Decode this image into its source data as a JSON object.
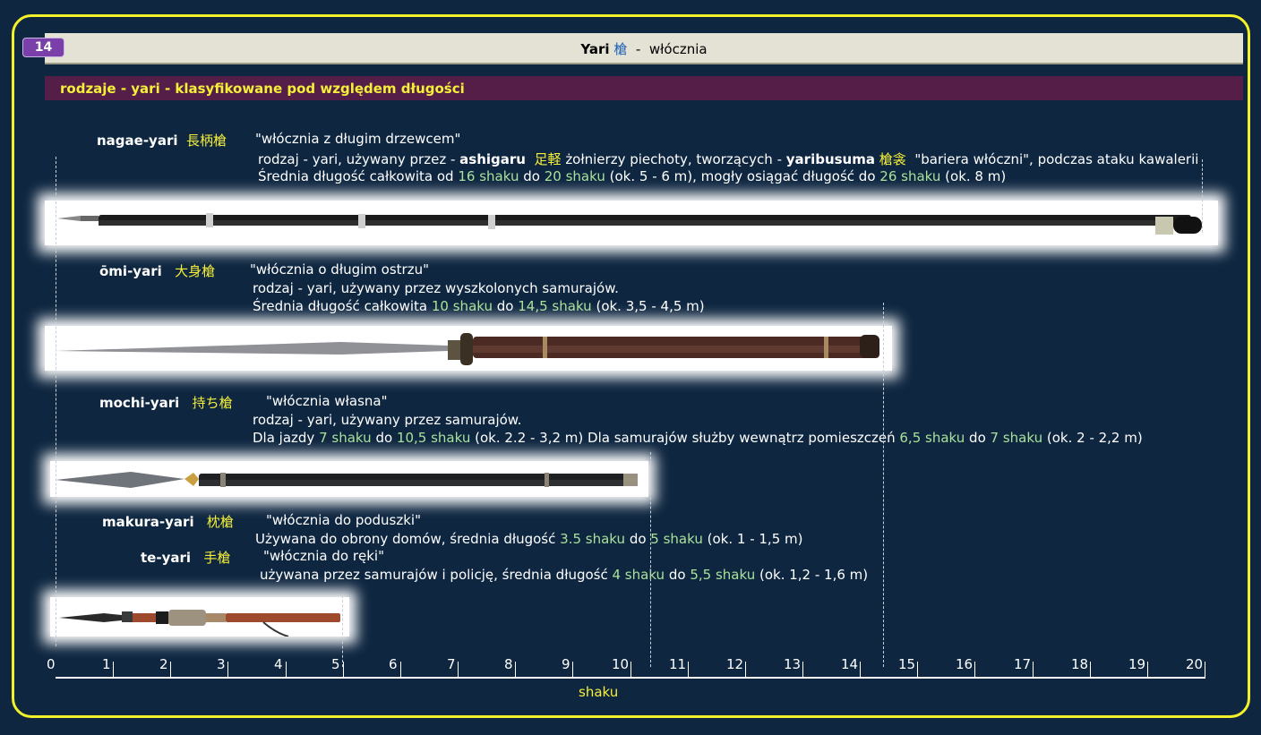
{
  "header": {
    "page_number": "14",
    "title_bold": "Yari",
    "title_kanji": "槍",
    "title_sep": "-",
    "title_rest": "włócznia"
  },
  "section": {
    "subtitle": "rodzaje - yari - klasyfikowane pod względem długości"
  },
  "nagae": {
    "name": "nagae-yari",
    "kanji": "長柄槍",
    "meaning": "\"włócznia z długim drzewcem\"",
    "l2a": "rodzaj - yari, używany przez -",
    "l2b": "ashigaru",
    "l2c": "足軽",
    "l2d": "żołnierzy piechoty, tworzących -",
    "l2e": "yaribusuma",
    "l2f": "槍衾",
    "l2g": "\"bariera włóczni\", podczas ataku kawalerii",
    "l3a": "Średnia długość całkowita od",
    "l3b": "16 shaku",
    "l3c": "do",
    "l3d": "20 shaku",
    "l3e": "(ok. 5 - 6 m), mogły osiągać długość do",
    "l3f": "26 shaku",
    "l3g": "(ok. 8 m)"
  },
  "omi": {
    "name": "ōmi-yari",
    "kanji": "大身槍",
    "meaning": "\"włócznia  o długim ostrzu\"",
    "l2": "rodzaj - yari, używany przez wyszkolonych samurajów.",
    "l3a": "Średnia długość całkowita",
    "l3b": "10 shaku",
    "l3c": "do",
    "l3d": "14,5 shaku",
    "l3e": "(ok. 3,5 - 4,5 m)"
  },
  "mochi": {
    "name": "mochi-yari",
    "kanji": "持ち槍",
    "meaning": "\"włócznia  własna\"",
    "l2": "rodzaj - yari, używany przez samurajów.",
    "l3a": "Dla jazdy",
    "l3b": "7 shaku",
    "l3c": "do",
    "l3d": "10,5 shaku",
    "l3e": "(ok. 2.2 - 3,2 m) Dla samurajów służby wewnątrz pomieszczeń",
    "l3f": "6,5 shaku",
    "l3g": "do",
    "l3h": "7 shaku",
    "l3i": "(ok. 2 - 2,2 m)"
  },
  "makura": {
    "name": "makura-yari",
    "kanji": "枕槍",
    "meaning": "\"włócznia  do poduszki\"",
    "l2a": "Używana do obrony domów, średnia długość",
    "l2b": "3.5 shaku",
    "l2c": "do",
    "l2d": "5 shaku",
    "l2e": "(ok. 1 - 1,5 m)"
  },
  "te": {
    "name": "te-yari",
    "kanji": "手槍",
    "meaning": "\"włócznia  do ręki\"",
    "l2a": "używana przez samurajów i policję, średnia długość",
    "l2b": "4 shaku",
    "l2c": "do",
    "l2d": "5,5 shaku",
    "l2e": "(ok. 1,2 - 1,6 m)"
  },
  "axis": {
    "unit": "shaku",
    "ticks": [
      "0",
      "1",
      "2",
      "3",
      "4",
      "5",
      "6",
      "7",
      "8",
      "9",
      "10",
      "11",
      "12",
      "13",
      "14",
      "15",
      "16",
      "17",
      "18",
      "19",
      "20"
    ]
  },
  "colors": {
    "accent_yellow": "#f5ef3a",
    "value_green": "#a9e19a",
    "background": "#0e2640",
    "subtitle_bar": "#541e49",
    "badge": "#7a3fa8"
  }
}
